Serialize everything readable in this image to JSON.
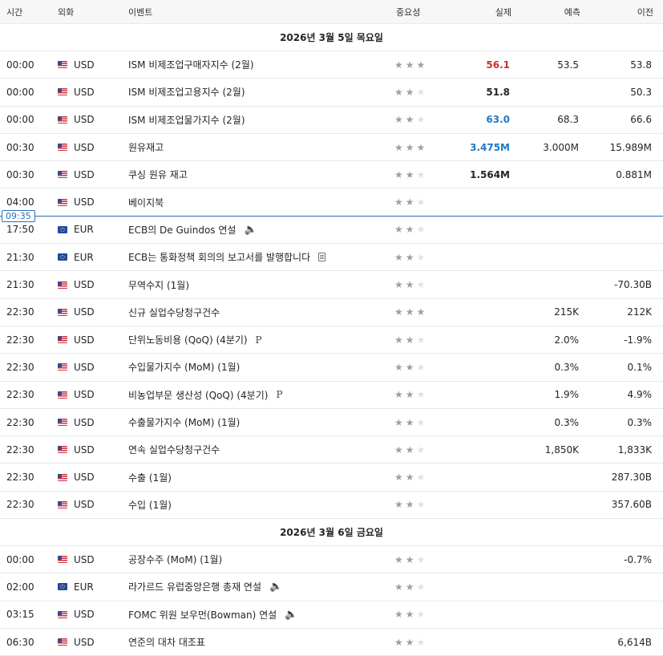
{
  "columns": {
    "time": "시간",
    "currency": "외화",
    "event": "이벤트",
    "importance": "중요성",
    "actual": "실제",
    "forecast": "예측",
    "previous": "이전"
  },
  "now_marker": "09:35",
  "colors": {
    "accent": "#2a72b8",
    "better": "#c9302c",
    "worse": "#1e78c8"
  },
  "days": [
    {
      "label": "2026년 3월 5일 목요일",
      "rows": [
        {
          "time": "00:00",
          "currency": "USD",
          "flag": "us",
          "event": "ISM 비제조업구매자지수 (2월)",
          "stars": 3,
          "actual": "56.1",
          "actual_color": "red",
          "forecast": "53.5",
          "previous": "53.8",
          "extra": ""
        },
        {
          "time": "00:00",
          "currency": "USD",
          "flag": "us",
          "event": "ISM 비제조업고용지수 (2월)",
          "stars": 2,
          "actual": "51.8",
          "actual_color": "black",
          "forecast": "",
          "previous": "50.3",
          "extra": ""
        },
        {
          "time": "00:00",
          "currency": "USD",
          "flag": "us",
          "event": "ISM 비제조업물가지수 (2월)",
          "stars": 2,
          "actual": "63.0",
          "actual_color": "blue",
          "forecast": "68.3",
          "previous": "66.6",
          "extra": ""
        },
        {
          "time": "00:30",
          "currency": "USD",
          "flag": "us",
          "event": "원유재고",
          "stars": 3,
          "actual": "3.475M",
          "actual_color": "blue",
          "forecast": "3.000M",
          "previous": "15.989M",
          "extra": ""
        },
        {
          "time": "00:30",
          "currency": "USD",
          "flag": "us",
          "event": "쿠싱 원유 재고",
          "stars": 2,
          "actual": "1.564M",
          "actual_color": "black",
          "forecast": "",
          "previous": "0.881M",
          "extra": ""
        },
        {
          "time": "04:00",
          "currency": "USD",
          "flag": "us",
          "event": "베이지북",
          "stars": 2,
          "actual": "",
          "actual_color": "black",
          "forecast": "",
          "previous": "",
          "extra": ""
        },
        {
          "time": "17:50",
          "currency": "EUR",
          "flag": "eu",
          "event": "ECB의 De Guindos 연설",
          "stars": 2,
          "actual": "",
          "actual_color": "black",
          "forecast": "",
          "previous": "",
          "extra": "speaker"
        },
        {
          "time": "21:30",
          "currency": "EUR",
          "flag": "eu",
          "event": "ECB는 통화정책 회의의 보고서를 발행합니다",
          "stars": 2,
          "actual": "",
          "actual_color": "black",
          "forecast": "",
          "previous": "",
          "extra": "doc"
        },
        {
          "time": "21:30",
          "currency": "USD",
          "flag": "us",
          "event": "무역수지 (1월)",
          "stars": 2,
          "actual": "",
          "actual_color": "black",
          "forecast": "",
          "previous": "-70.30B",
          "extra": ""
        },
        {
          "time": "22:30",
          "currency": "USD",
          "flag": "us",
          "event": "신규 실업수당청구건수",
          "stars": 3,
          "actual": "",
          "actual_color": "black",
          "forecast": "215K",
          "previous": "212K",
          "extra": ""
        },
        {
          "time": "22:30",
          "currency": "USD",
          "flag": "us",
          "event": "단위노동비용 (QoQ) (4분기)",
          "stars": 2,
          "actual": "",
          "actual_color": "black",
          "forecast": "2.0%",
          "previous": "-1.9%",
          "extra": "prelim"
        },
        {
          "time": "22:30",
          "currency": "USD",
          "flag": "us",
          "event": "수입물가지수 (MoM) (1월)",
          "stars": 2,
          "actual": "",
          "actual_color": "black",
          "forecast": "0.3%",
          "previous": "0.1%",
          "extra": ""
        },
        {
          "time": "22:30",
          "currency": "USD",
          "flag": "us",
          "event": "비농업부문 생산성 (QoQ) (4분기)",
          "stars": 2,
          "actual": "",
          "actual_color": "black",
          "forecast": "1.9%",
          "previous": "4.9%",
          "extra": "prelim"
        },
        {
          "time": "22:30",
          "currency": "USD",
          "flag": "us",
          "event": "수출물가지수 (MoM) (1월)",
          "stars": 2,
          "actual": "",
          "actual_color": "black",
          "forecast": "0.3%",
          "previous": "0.3%",
          "extra": ""
        },
        {
          "time": "22:30",
          "currency": "USD",
          "flag": "us",
          "event": "연속 실업수당청구건수",
          "stars": 2,
          "actual": "",
          "actual_color": "black",
          "forecast": "1,850K",
          "previous": "1,833K",
          "extra": ""
        },
        {
          "time": "22:30",
          "currency": "USD",
          "flag": "us",
          "event": "수출 (1월)",
          "stars": 2,
          "actual": "",
          "actual_color": "black",
          "forecast": "",
          "previous": "287.30B",
          "extra": ""
        },
        {
          "time": "22:30",
          "currency": "USD",
          "flag": "us",
          "event": "수입 (1월)",
          "stars": 2,
          "actual": "",
          "actual_color": "black",
          "forecast": "",
          "previous": "357.60B",
          "extra": ""
        }
      ]
    },
    {
      "label": "2026년 3월 6일 금요일",
      "rows": [
        {
          "time": "00:00",
          "currency": "USD",
          "flag": "us",
          "event": "공장수주 (MoM) (1월)",
          "stars": 2,
          "actual": "",
          "actual_color": "black",
          "forecast": "",
          "previous": "-0.7%",
          "extra": ""
        },
        {
          "time": "02:00",
          "currency": "EUR",
          "flag": "eu",
          "event": "라가르드 유럽중앙은행 총재 연설",
          "stars": 2,
          "actual": "",
          "actual_color": "black",
          "forecast": "",
          "previous": "",
          "extra": "speaker"
        },
        {
          "time": "03:15",
          "currency": "USD",
          "flag": "us",
          "event": "FOMC 위원 보우먼(Bowman) 연설",
          "stars": 2,
          "actual": "",
          "actual_color": "black",
          "forecast": "",
          "previous": "",
          "extra": "speaker"
        },
        {
          "time": "06:30",
          "currency": "USD",
          "flag": "us",
          "event": "연준의 대차 대조표",
          "stars": 2,
          "actual": "",
          "actual_color": "black",
          "forecast": "",
          "previous": "6,614B",
          "extra": ""
        }
      ]
    }
  ]
}
